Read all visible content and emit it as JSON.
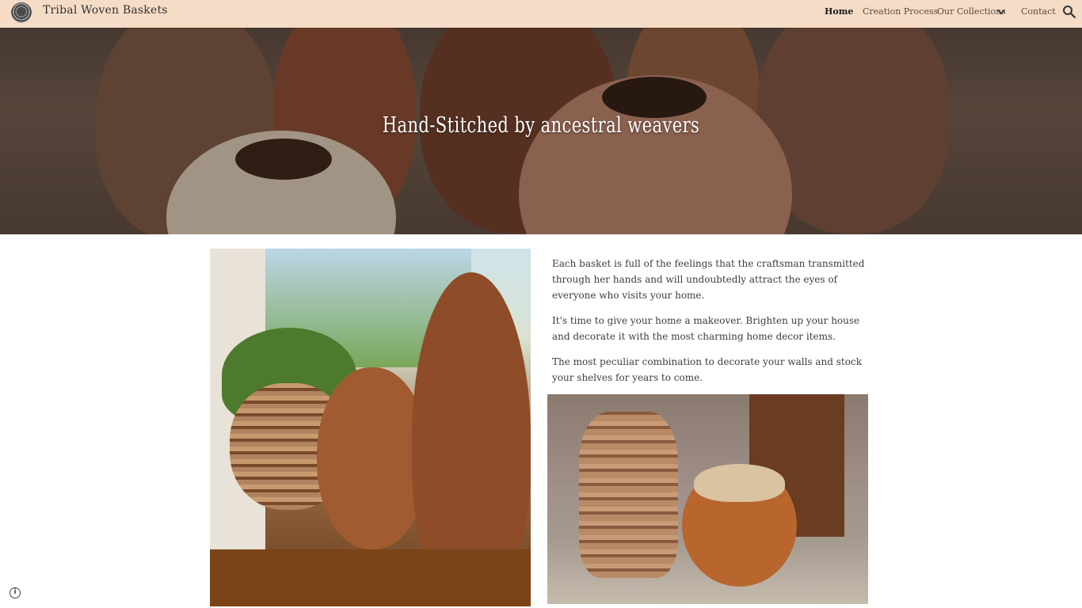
{
  "site": {
    "title": "Tribal Woven Baskets"
  },
  "nav": {
    "items": [
      {
        "label": "Home",
        "active": true
      },
      {
        "label": "Creation Process",
        "active": false
      },
      {
        "label": "Our Collections",
        "active": false,
        "has_dropdown": true
      },
      {
        "label": "Contact",
        "active": false
      }
    ]
  },
  "icons": {
    "logo": "woven-basket-logo",
    "search": "search-icon",
    "dropdown": "chevron-down-icon",
    "info": "info-icon"
  },
  "hero": {
    "title": "Hand-Stitched by ancestral weavers"
  },
  "content": {
    "paragraphs": [
      "Each basket is full of the feelings that the craftsman transmitted through her hands and will undoubtedly attract the eyes of everyone who visits your home.",
      "It's time to give your home a makeover. Brighten up your house and decorate it with the most charming home decor items.",
      "The most peculiar combination to decorate your walls and stock your shelves for years to come."
    ]
  },
  "colors": {
    "header_bg": "#f5dcc7",
    "text": "#3d3d3d",
    "hero_text": "#ffffff"
  }
}
